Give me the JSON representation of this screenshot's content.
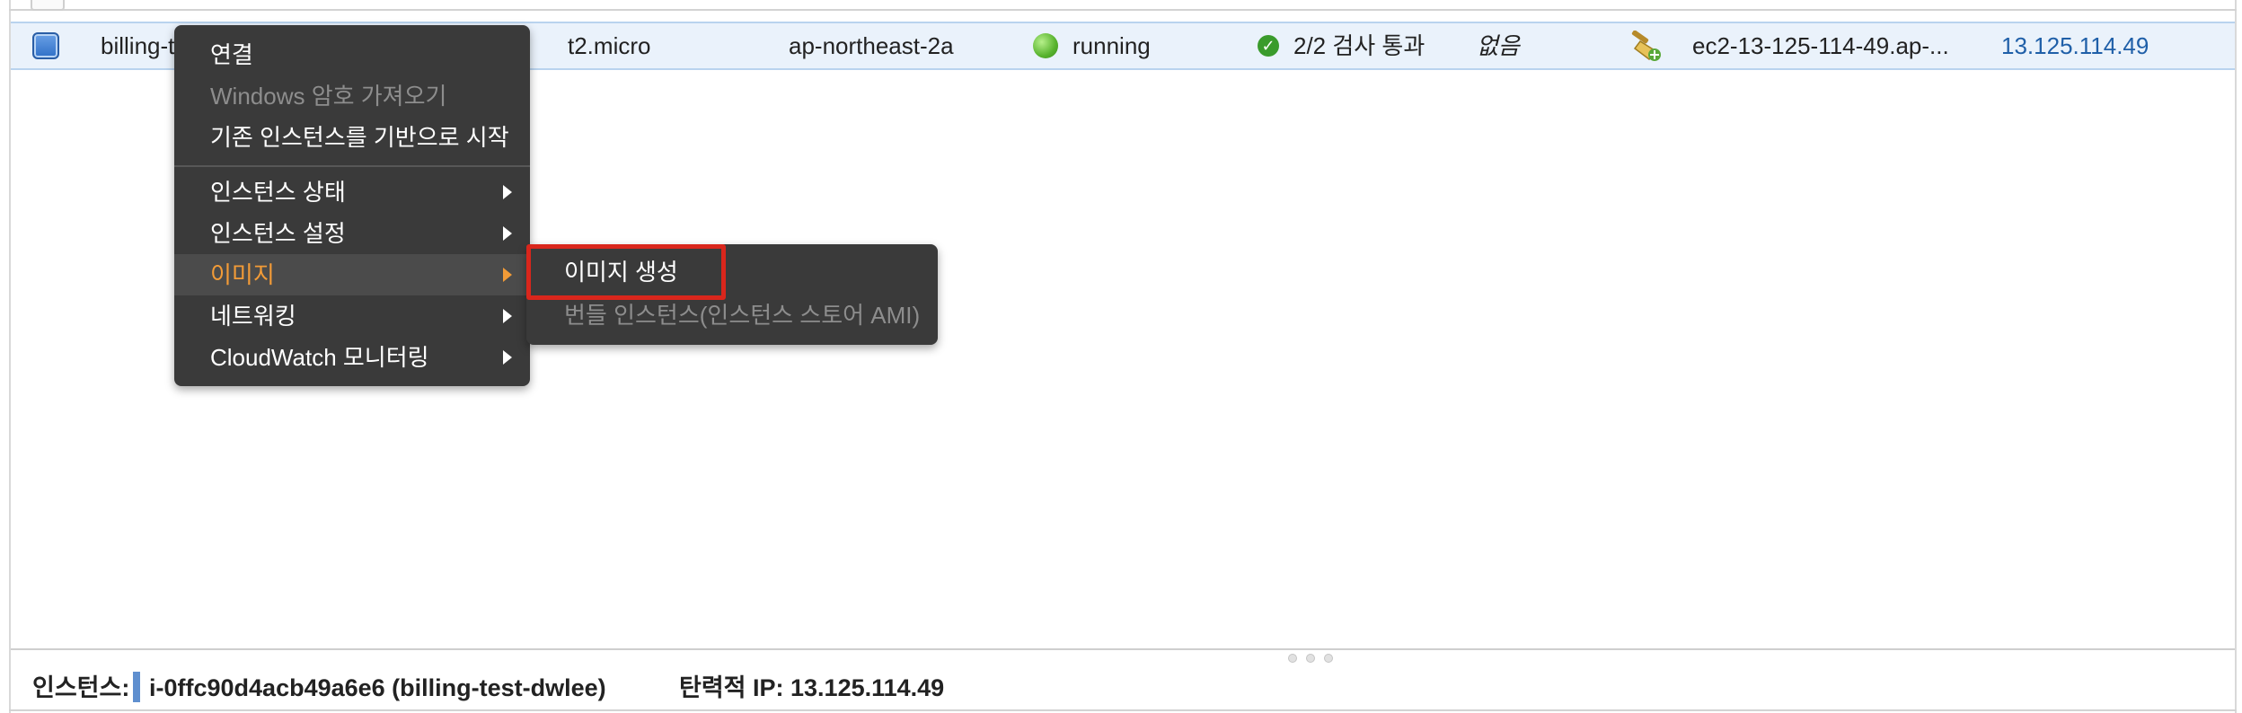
{
  "row": {
    "name": "billing-t",
    "instance_type": "t2.micro",
    "availability_zone": "ap-northeast-2a",
    "state": "running",
    "status_check": "2/2 검사 통과",
    "alarm_status": "없음",
    "public_dns": "ec2-13-125-114-49.ap-...",
    "public_ip": "13.125.114.49"
  },
  "context_menu": {
    "items": [
      {
        "label": "연결"
      },
      {
        "label": "Windows 암호 가져오기"
      },
      {
        "label": "기존 인스턴스를 기반으로 시작"
      },
      {
        "label": "인스턴스 상태"
      },
      {
        "label": "인스턴스 설정"
      },
      {
        "label": "이미지"
      },
      {
        "label": "네트워킹"
      },
      {
        "label": "CloudWatch 모니터링"
      }
    ]
  },
  "submenu": {
    "items": [
      {
        "label": "이미지 생성"
      },
      {
        "label": "번들 인스턴스(인스턴스 스토어 AMI)"
      }
    ]
  },
  "footer": {
    "instance_label": "인스턴스:",
    "instance_id": "i-0ffc90d4acb49a6e6 (billing-test-dwlee)",
    "elastic_ip": "탄력적 IP: 13.125.114.49"
  },
  "colors": {
    "menu_bg": "#3a3a3a",
    "active_text": "#f29b37",
    "highlight_border": "#d9261c",
    "link": "#1f5fa8",
    "row_selected": "#eaf2fb"
  },
  "icons": [
    "checkbox-icon",
    "running-status-icon",
    "check-circle-icon",
    "broom-icon",
    "submenu-arrow-icon",
    "resize-grip-icon"
  ]
}
